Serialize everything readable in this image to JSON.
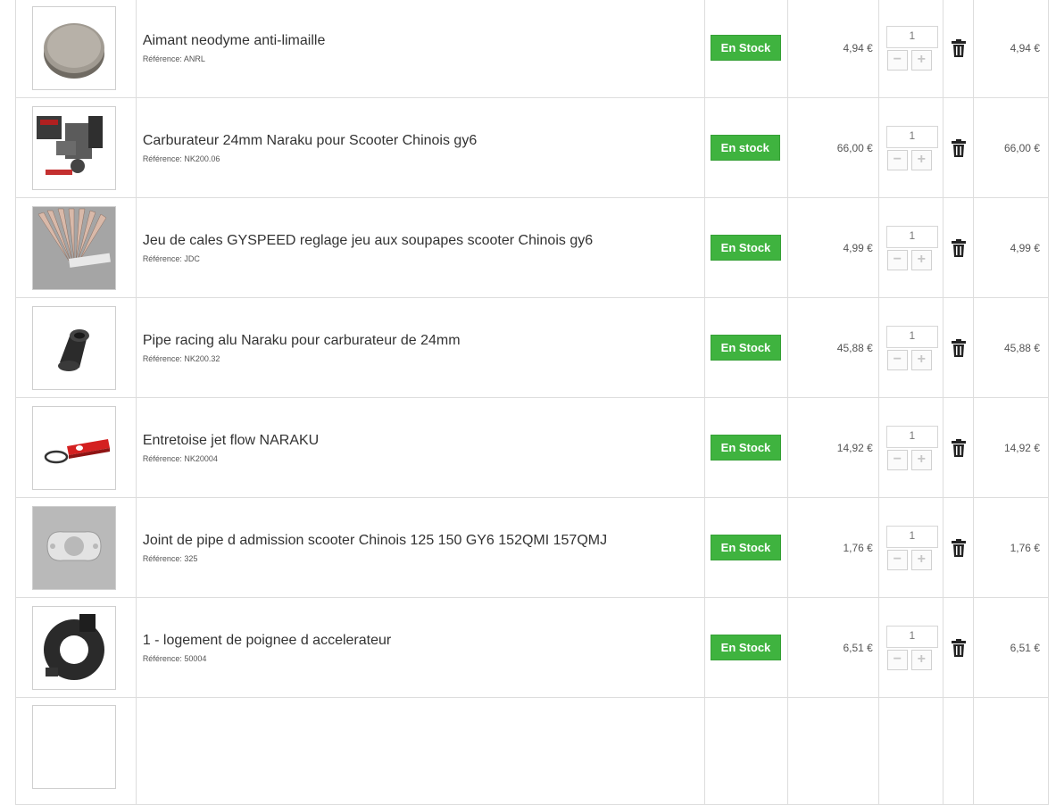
{
  "cart": {
    "items": [
      {
        "name": "Aimant neodyme anti-limaille",
        "reference": "Référence: ANRL",
        "availability": "En Stock",
        "unit_price": "4,94 €",
        "quantity": "1",
        "total": "4,94 €"
      },
      {
        "name": "Carburateur 24mm Naraku pour Scooter Chinois gy6",
        "reference": "Référence: NK200.06",
        "availability": "En stock",
        "unit_price": "66,00 €",
        "quantity": "1",
        "total": "66,00 €"
      },
      {
        "name": "Jeu de cales GYSPEED reglage jeu aux soupapes scooter Chinois gy6",
        "reference": "Référence: JDC",
        "availability": "En Stock",
        "unit_price": "4,99 €",
        "quantity": "1",
        "total": "4,99 €"
      },
      {
        "name": "Pipe racing alu Naraku pour carburateur de 24mm",
        "reference": "Référence: NK200.32",
        "availability": "En Stock",
        "unit_price": "45,88 €",
        "quantity": "1",
        "total": "45,88 €"
      },
      {
        "name": "Entretoise jet flow NARAKU",
        "reference": "Référence: NK20004",
        "availability": "En Stock",
        "unit_price": "14,92 €",
        "quantity": "1",
        "total": "14,92 €"
      },
      {
        "name": "Joint de pipe d admission scooter Chinois 125 150 GY6 152QMI 157QMJ",
        "reference": "Référence: 325",
        "availability": "En Stock",
        "unit_price": "1,76 €",
        "quantity": "1",
        "total": "1,76 €"
      },
      {
        "name": "1 - logement de poignee d accelerateur",
        "reference": "Référence: 50004",
        "availability": "En Stock",
        "unit_price": "6,51 €",
        "quantity": "1",
        "total": "6,51 €"
      }
    ]
  },
  "controls": {
    "decrease": "−",
    "increase": "+"
  },
  "icons": {
    "delete": "trash-icon"
  },
  "colors": {
    "stock_badge": "#3fb33f",
    "border": "#dddddd"
  }
}
